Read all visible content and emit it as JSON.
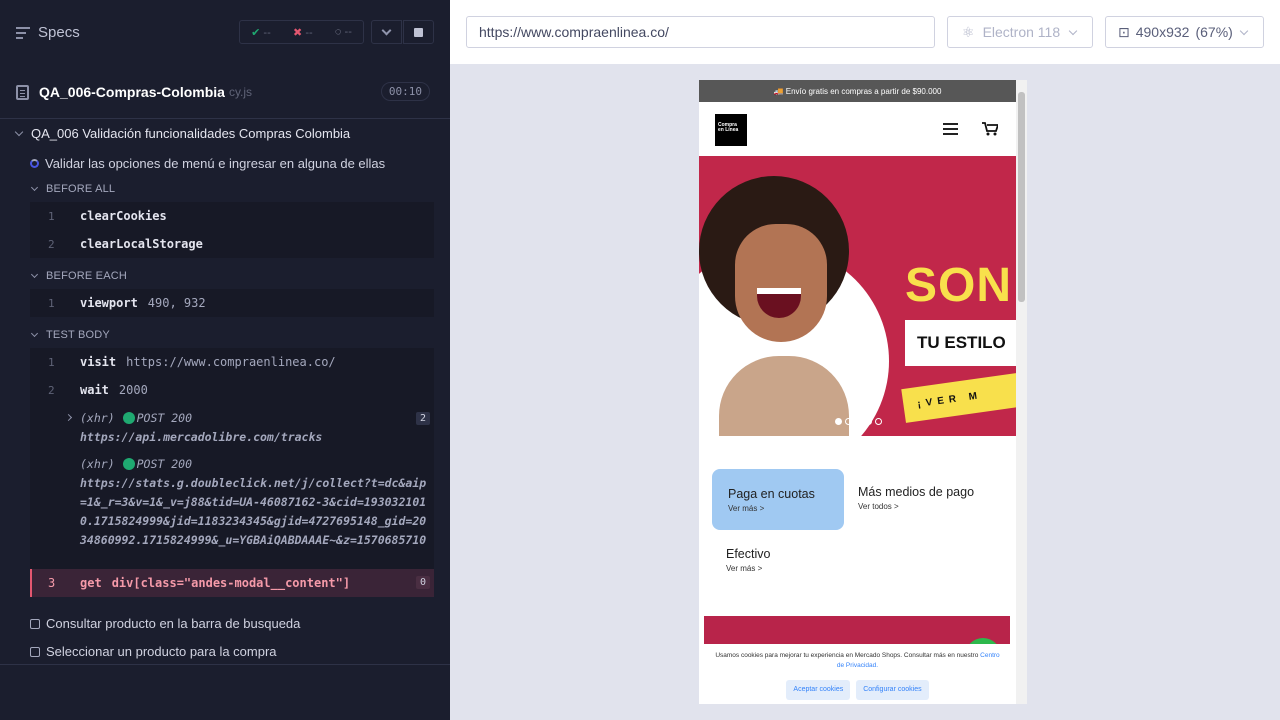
{
  "runner": {
    "header": {
      "title": "Specs",
      "passed": "--",
      "failed": "--",
      "pending": "--"
    },
    "spec": {
      "name": "QA_006-Compras-Colombia",
      "ext": "cy.js",
      "duration": "00:10"
    },
    "suite": "QA_006 Validación funcionalidades Compras Colombia",
    "tests": {
      "active": "Validar las opciones de menú e ingresar en alguna de ellas",
      "pending": [
        "Consultar producto en la barra de busqueda",
        "Seleccionar un producto para la compra"
      ]
    },
    "sections": {
      "before_all": "BEFORE ALL",
      "before_each": "BEFORE EACH",
      "test_body": "TEST BODY"
    },
    "before_all": [
      {
        "num": "1",
        "name": "clearCookies",
        "arg": ""
      },
      {
        "num": "2",
        "name": "clearLocalStorage",
        "arg": ""
      }
    ],
    "before_each": [
      {
        "num": "1",
        "name": "viewport",
        "arg": "490, 932"
      }
    ],
    "body": [
      {
        "num": "1",
        "name": "visit",
        "arg": "https://www.compraenlinea.co/"
      },
      {
        "num": "2",
        "name": "wait",
        "arg": "2000"
      }
    ],
    "xhr1": {
      "label": "(xhr)",
      "method": "POST 200",
      "url": "https://api.mercadolibre.com/tracks",
      "count": "2"
    },
    "xhr2": {
      "label": "(xhr)",
      "method": "POST 200",
      "url": "https://stats.g.doubleclick.net/j/collect?t=dc&aip=1&_r=3&v=1&_v=j88&tid=UA-46087162-3&cid=1930321010.1715824999&jid=1183234345&gjid=4727695148_gid=2034860992.1715824999&_u=YGBAiQABDAAAE~&z=1570685710"
    },
    "failed_cmd": {
      "num": "3",
      "name": "get",
      "arg": "div[class=\"andes-modal__content\"]",
      "count": "0"
    }
  },
  "preview": {
    "url": "https://www.compraenlinea.co/",
    "browser": "Electron 118",
    "viewport": "490x932",
    "scale": "(67%)",
    "site": {
      "promo": "Envío gratis en compras a partir de $90.000",
      "logo_text": "Compra en Línea",
      "hero_line1": "SON",
      "hero_line2": "TU ESTILO",
      "hero_cta": "¡VER M",
      "pay1_title": "Paga en cuotas",
      "pay1_link": "Ver más >",
      "pay2_title": "Más medios de pago",
      "pay2_link": "Ver todos >",
      "pay3_title": "Efectivo",
      "pay3_link": "Ver más >",
      "cookie_text": "Usamos cookies para mejorar tu experiencia en Mercado Shops. Consultar más en nuestro",
      "cookie_link": "Centro de Privacidad.",
      "accept": "Aceptar cookies",
      "configure": "Configurar cookies"
    }
  },
  "colors": {
    "pass": "#1fa971",
    "fail": "#e45770",
    "hero": "#c1274a",
    "accent": "#3483fa"
  }
}
